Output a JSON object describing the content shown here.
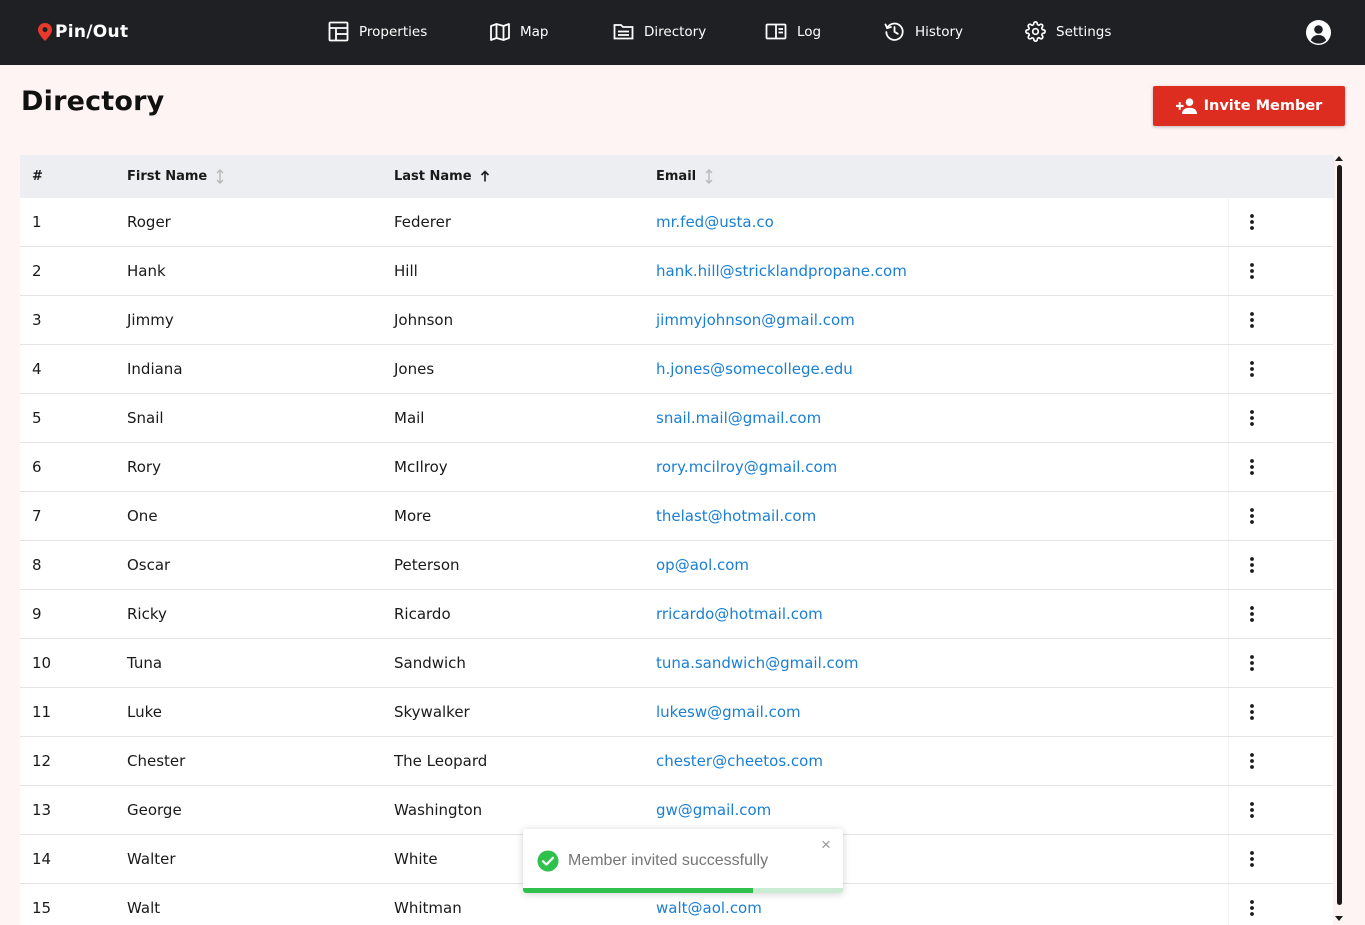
{
  "brand": {
    "name": "Pin/Out",
    "pin_color": "#e8392d"
  },
  "nav": {
    "items": [
      {
        "label": "Properties",
        "icon": "properties-icon"
      },
      {
        "label": "Map",
        "icon": "map-icon"
      },
      {
        "label": "Directory",
        "icon": "directory-icon"
      },
      {
        "label": "Log",
        "icon": "log-icon"
      },
      {
        "label": "History",
        "icon": "history-icon"
      },
      {
        "label": "Settings",
        "icon": "gear-icon"
      }
    ],
    "account_icon": "account-icon"
  },
  "page": {
    "title": "Directory",
    "invite_label": "Invite Member",
    "accent": "#dc2d20"
  },
  "table": {
    "columns": {
      "index": "#",
      "first_name": "First Name",
      "last_name": "Last Name",
      "email": "Email"
    },
    "sort": {
      "column": "last_name",
      "direction": "ascending"
    },
    "rows": [
      {
        "index": "1",
        "first": "Roger",
        "last": "Federer",
        "email": "mr.fed@usta.co"
      },
      {
        "index": "2",
        "first": "Hank",
        "last": "Hill",
        "email": "hank.hill@stricklandpropane.com"
      },
      {
        "index": "3",
        "first": "Jimmy",
        "last": "Johnson",
        "email": "jimmyjohnson@gmail.com"
      },
      {
        "index": "4",
        "first": "Indiana",
        "last": "Jones",
        "email": "h.jones@somecollege.edu"
      },
      {
        "index": "5",
        "first": "Snail",
        "last": "Mail",
        "email": "snail.mail@gmail.com"
      },
      {
        "index": "6",
        "first": "Rory",
        "last": "McIlroy",
        "email": "rory.mcilroy@gmail.com"
      },
      {
        "index": "7",
        "first": "One",
        "last": "More",
        "email": "thelast@hotmail.com"
      },
      {
        "index": "8",
        "first": "Oscar",
        "last": "Peterson",
        "email": "op@aol.com"
      },
      {
        "index": "9",
        "first": "Ricky",
        "last": "Ricardo",
        "email": "rricardo@hotmail.com"
      },
      {
        "index": "10",
        "first": "Tuna",
        "last": "Sandwich",
        "email": "tuna.sandwich@gmail.com"
      },
      {
        "index": "11",
        "first": "Luke",
        "last": "Skywalker",
        "email": "lukesw@gmail.com"
      },
      {
        "index": "12",
        "first": "Chester",
        "last": "The Leopard",
        "email": "chester@cheetos.com"
      },
      {
        "index": "13",
        "first": "George",
        "last": "Washington",
        "email": "gw@gmail.com"
      },
      {
        "index": "14",
        "first": "Walter",
        "last": "White",
        "email": ""
      },
      {
        "index": "15",
        "first": "Walt",
        "last": "Whitman",
        "email": "walt@aol.com"
      }
    ],
    "row_menu_icon": "more-vertical-icon",
    "link_color": "#1a7fd4"
  },
  "toast": {
    "message": "Member invited successfully",
    "close_label": "×",
    "icon": "check-circle-icon",
    "progress": 0.72,
    "success_color": "#2fc14c"
  }
}
